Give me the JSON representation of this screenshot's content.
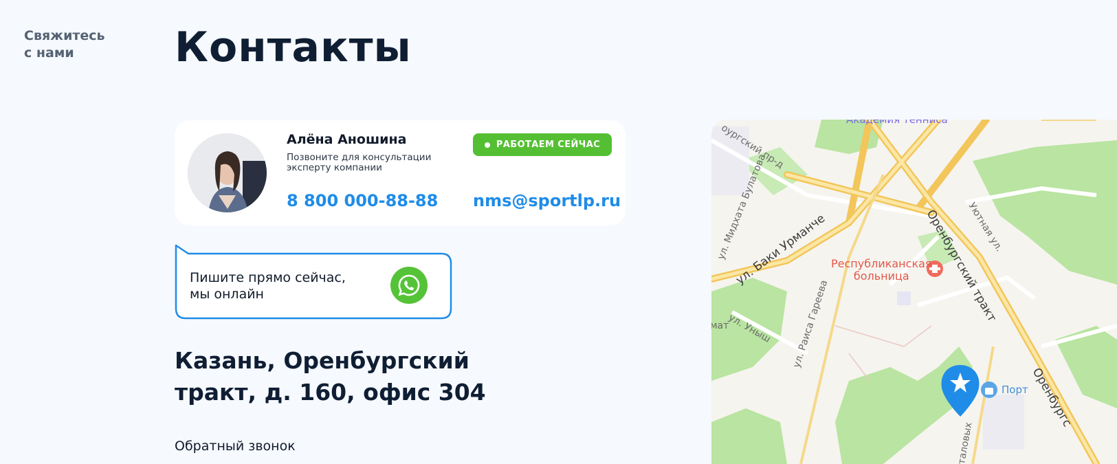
{
  "side": {
    "label": "Свяжитесь\nс нами"
  },
  "page": {
    "title": "Контакты"
  },
  "contact": {
    "name": "Алёна Аношина",
    "description": "Позвоните для консультации эксперту компании",
    "status": "РАБОТАЕМ СЕЙЧАС",
    "phone": "8 800 000-88-88",
    "email": "nms@sportlp.ru"
  },
  "chat": {
    "text": "Пишите прямо сейчас,\nмы онлайн"
  },
  "address": "Казань, Оренбургский\nтракт, д. 160, офис 304",
  "callback": "Обратный звонок",
  "map": {
    "labels": {
      "academy": "Академия\nтенниса",
      "ave_partial": "оургский пр-д",
      "bulatova": "ул. Мидхата Булатова",
      "urmanche": "ул. Баки Урманче",
      "orenburg1": "Оренбургский тракт",
      "orenburg2": "Оренбургс",
      "uyutnaya": "Уютная ул.",
      "hospital": "Республиканская\nбольница",
      "gareeva": "ул. Раиса Гареева",
      "unysh": "ул. Уныш",
      "mat": "мат",
      "port": "Порт",
      "talovyh": "таловых"
    },
    "colors": {
      "park": "#b9e4a1",
      "road_major": "#f7d47c",
      "pin": "#1f8ce8",
      "land": "#f6f4ef"
    }
  },
  "colors": {
    "accent": "#1f8ce8",
    "status": "#55bf33",
    "whatsapp": "#55c337",
    "text": "#0f1e33"
  }
}
